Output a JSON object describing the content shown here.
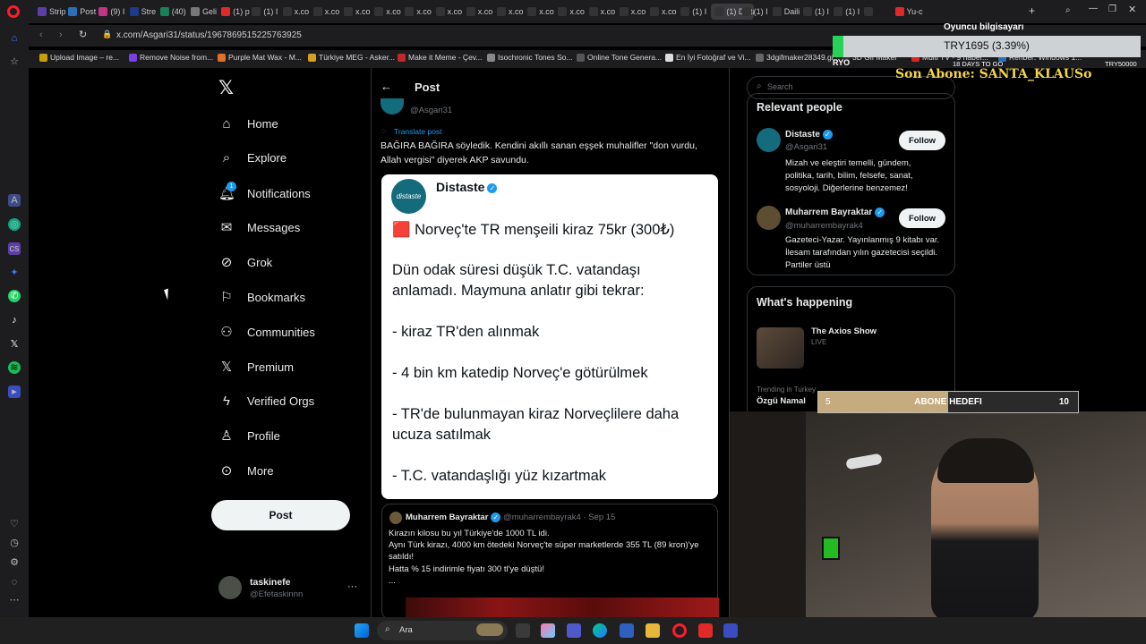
{
  "tabs": [
    "Strip",
    "Post",
    "(9) I",
    "Stre",
    "(40)",
    "Geli",
    "(1) p",
    "(1) I",
    "x.co",
    "x.co",
    "x.co",
    "x.co",
    "x.co",
    "x.co",
    "x.co",
    "x.co",
    "x.co",
    "x.co",
    "x.co",
    "x.co",
    "x.co",
    "(1) I",
    "(1) Dista",
    "(1) I",
    "Daili",
    "(1) I",
    "(1) I",
    "",
    "Yu-c"
  ],
  "url": "x.com/Asgari31/status/1967869515225763925",
  "bookmarks": [
    "Upload Image – re...",
    "Remove Noise from...",
    "Purple Mat Wax - M...",
    "Türkiye MEG - Asker...",
    "Make it Meme - Çev...",
    "Isochronic Tones So...",
    "Online Tone Genera...",
    "En İyi Fotoğraf ve Vi...",
    "3dgifmaker28349.gi...",
    "3D Gif Maker",
    "Multi TV - 9 haber...",
    "Rehber: Windows 1..."
  ],
  "nav": {
    "items": [
      "Home",
      "Explore",
      "Notifications",
      "Messages",
      "Grok",
      "Bookmarks",
      "Communities",
      "Premium",
      "Verified Orgs",
      "Profile",
      "More"
    ],
    "notif_badge": "1",
    "post_label": "Post",
    "user_name": "taskinefe",
    "user_handle": "@Efetaskinnn",
    "more_dots": "···"
  },
  "header": {
    "title": "Post",
    "back": "←"
  },
  "post": {
    "handle": "@Asgari31",
    "translate": "Translate post",
    "text_line1": "BAĞIRA BAĞIRA söyledik. Kendini akıllı sanan eşşek muhalifler \"don vurdu,",
    "text_line2": "Allah vergisi\" diyerek AKP savundu."
  },
  "embed": {
    "avatar_text": "distaste",
    "name": "Distaste",
    "lines": [
      "🟥 Norveç'te TR menşeili kiraz 75kr (300₺)",
      "Dün odak süresi düşük T.C. vatandaşı",
      "anlamadı. Maymuna anlatır gibi tekrar:",
      "- kiraz TR'den alınmak",
      "- 4 bin km katedip Norveç'e götürülmek",
      "- TR'de bulunmayan kiraz Norveçlilere daha",
      "ucuza satılmak",
      "- T.C. vatandaşlığı yüz kızartmak"
    ]
  },
  "quote": {
    "name": "Muharrem Bayraktar",
    "meta": "@muharrembayrak4 · Sep 15",
    "lines": [
      "Kirazın kilosu bu yıl Türkiye'de 1000 TL idi.",
      "Aynı Türk kirazı, 4000 km ötedeki Norveç'te süper marketlerde 355 TL (89 kron)'ye",
      "satıldı!",
      "Hatta % 15 indirimle fiyatı 300 tl'ye düştü!",
      "..."
    ]
  },
  "right": {
    "search_placeholder": "Search",
    "relevant_title": "Relevant people",
    "people": [
      {
        "name": "Distaste",
        "handle": "@Asgari31",
        "bio": [
          "Mizah ve eleştiri temelli, gündem,",
          "politika, tarih, bilim, felsefe, sanat,",
          "sosyoloji. Diğerlerine benzemez!"
        ],
        "follow": "Follow"
      },
      {
        "name": "Muharrem Bayraktar",
        "handle": "@muharrembayrak4",
        "bio": [
          "Gazeteci-Yazar. Yayınlanmış 9 kitabı var.",
          "İlesam tarafından yılın gazetecisi seçildi.",
          "Partiler üstü"
        ],
        "follow": "Follow"
      }
    ],
    "happening_title": "What's happening",
    "show_title": "The Axios Show",
    "show_live": "LIVE",
    "trending_label": "Trending in Turkey",
    "trending_item": "Özgü Namal"
  },
  "overlay": {
    "game_title": "Oyuncu bilgisayarı",
    "try_value": "TRY1695 (3.39%)",
    "ryo": "RYO",
    "days": "18 DAYS TO GO",
    "try_target": "TRY50000",
    "progress_fraction": 0.0339,
    "last_sub": "Son Abone: SANTA_KLAUSo",
    "goal_left": "5",
    "goal_label": "ABONE HEDEFI",
    "goal_right": "10",
    "goal_fraction": 0.5
  },
  "taskbar": {
    "search_label": "Ara"
  },
  "colors": {
    "accent": "#1d9bf0",
    "bg": "#000000",
    "gold": "#f5d547"
  }
}
